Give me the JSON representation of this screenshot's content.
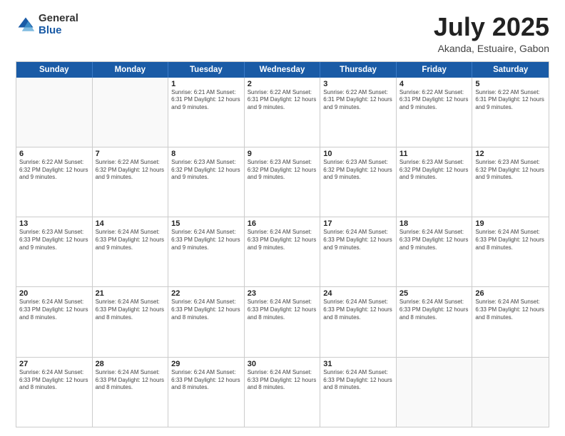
{
  "header": {
    "logo": {
      "general": "General",
      "blue": "Blue"
    },
    "title": "July 2025",
    "location": "Akanda, Estuaire, Gabon"
  },
  "days_of_week": [
    "Sunday",
    "Monday",
    "Tuesday",
    "Wednesday",
    "Thursday",
    "Friday",
    "Saturday"
  ],
  "weeks": [
    [
      {
        "day": "",
        "info": ""
      },
      {
        "day": "",
        "info": ""
      },
      {
        "day": "1",
        "info": "Sunrise: 6:21 AM\nSunset: 6:31 PM\nDaylight: 12 hours\nand 9 minutes."
      },
      {
        "day": "2",
        "info": "Sunrise: 6:22 AM\nSunset: 6:31 PM\nDaylight: 12 hours\nand 9 minutes."
      },
      {
        "day": "3",
        "info": "Sunrise: 6:22 AM\nSunset: 6:31 PM\nDaylight: 12 hours\nand 9 minutes."
      },
      {
        "day": "4",
        "info": "Sunrise: 6:22 AM\nSunset: 6:31 PM\nDaylight: 12 hours\nand 9 minutes."
      },
      {
        "day": "5",
        "info": "Sunrise: 6:22 AM\nSunset: 6:31 PM\nDaylight: 12 hours\nand 9 minutes."
      }
    ],
    [
      {
        "day": "6",
        "info": "Sunrise: 6:22 AM\nSunset: 6:32 PM\nDaylight: 12 hours\nand 9 minutes."
      },
      {
        "day": "7",
        "info": "Sunrise: 6:22 AM\nSunset: 6:32 PM\nDaylight: 12 hours\nand 9 minutes."
      },
      {
        "day": "8",
        "info": "Sunrise: 6:23 AM\nSunset: 6:32 PM\nDaylight: 12 hours\nand 9 minutes."
      },
      {
        "day": "9",
        "info": "Sunrise: 6:23 AM\nSunset: 6:32 PM\nDaylight: 12 hours\nand 9 minutes."
      },
      {
        "day": "10",
        "info": "Sunrise: 6:23 AM\nSunset: 6:32 PM\nDaylight: 12 hours\nand 9 minutes."
      },
      {
        "day": "11",
        "info": "Sunrise: 6:23 AM\nSunset: 6:32 PM\nDaylight: 12 hours\nand 9 minutes."
      },
      {
        "day": "12",
        "info": "Sunrise: 6:23 AM\nSunset: 6:32 PM\nDaylight: 12 hours\nand 9 minutes."
      }
    ],
    [
      {
        "day": "13",
        "info": "Sunrise: 6:23 AM\nSunset: 6:33 PM\nDaylight: 12 hours\nand 9 minutes."
      },
      {
        "day": "14",
        "info": "Sunrise: 6:24 AM\nSunset: 6:33 PM\nDaylight: 12 hours\nand 9 minutes."
      },
      {
        "day": "15",
        "info": "Sunrise: 6:24 AM\nSunset: 6:33 PM\nDaylight: 12 hours\nand 9 minutes."
      },
      {
        "day": "16",
        "info": "Sunrise: 6:24 AM\nSunset: 6:33 PM\nDaylight: 12 hours\nand 9 minutes."
      },
      {
        "day": "17",
        "info": "Sunrise: 6:24 AM\nSunset: 6:33 PM\nDaylight: 12 hours\nand 9 minutes."
      },
      {
        "day": "18",
        "info": "Sunrise: 6:24 AM\nSunset: 6:33 PM\nDaylight: 12 hours\nand 9 minutes."
      },
      {
        "day": "19",
        "info": "Sunrise: 6:24 AM\nSunset: 6:33 PM\nDaylight: 12 hours\nand 8 minutes."
      }
    ],
    [
      {
        "day": "20",
        "info": "Sunrise: 6:24 AM\nSunset: 6:33 PM\nDaylight: 12 hours\nand 8 minutes."
      },
      {
        "day": "21",
        "info": "Sunrise: 6:24 AM\nSunset: 6:33 PM\nDaylight: 12 hours\nand 8 minutes."
      },
      {
        "day": "22",
        "info": "Sunrise: 6:24 AM\nSunset: 6:33 PM\nDaylight: 12 hours\nand 8 minutes."
      },
      {
        "day": "23",
        "info": "Sunrise: 6:24 AM\nSunset: 6:33 PM\nDaylight: 12 hours\nand 8 minutes."
      },
      {
        "day": "24",
        "info": "Sunrise: 6:24 AM\nSunset: 6:33 PM\nDaylight: 12 hours\nand 8 minutes."
      },
      {
        "day": "25",
        "info": "Sunrise: 6:24 AM\nSunset: 6:33 PM\nDaylight: 12 hours\nand 8 minutes."
      },
      {
        "day": "26",
        "info": "Sunrise: 6:24 AM\nSunset: 6:33 PM\nDaylight: 12 hours\nand 8 minutes."
      }
    ],
    [
      {
        "day": "27",
        "info": "Sunrise: 6:24 AM\nSunset: 6:33 PM\nDaylight: 12 hours\nand 8 minutes."
      },
      {
        "day": "28",
        "info": "Sunrise: 6:24 AM\nSunset: 6:33 PM\nDaylight: 12 hours\nand 8 minutes."
      },
      {
        "day": "29",
        "info": "Sunrise: 6:24 AM\nSunset: 6:33 PM\nDaylight: 12 hours\nand 8 minutes."
      },
      {
        "day": "30",
        "info": "Sunrise: 6:24 AM\nSunset: 6:33 PM\nDaylight: 12 hours\nand 8 minutes."
      },
      {
        "day": "31",
        "info": "Sunrise: 6:24 AM\nSunset: 6:33 PM\nDaylight: 12 hours\nand 8 minutes."
      },
      {
        "day": "",
        "info": ""
      },
      {
        "day": "",
        "info": ""
      }
    ]
  ]
}
